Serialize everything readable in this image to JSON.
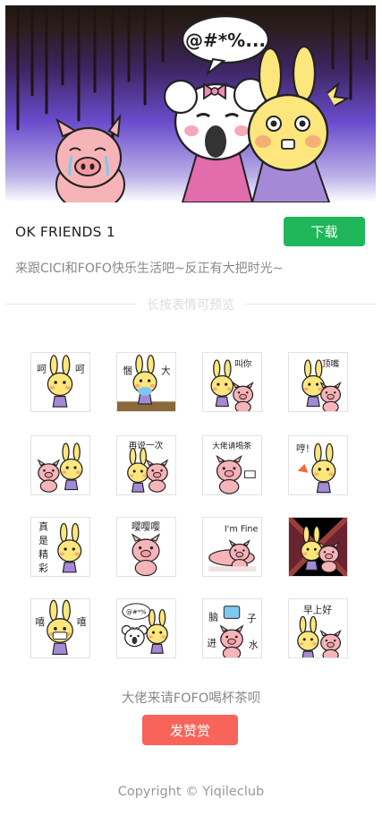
{
  "banner": {
    "speech_text": "@#*%...",
    "characters": [
      "pig-crying",
      "bear-with-bow",
      "bunny-surprised"
    ]
  },
  "pack": {
    "name": "OK FRIENDS 1",
    "download_label": "下载",
    "description": "来跟CICI和FOFO快乐生活吧~反正有大把时光~"
  },
  "preview_hint": "长按表情可预览",
  "stickers": [
    {
      "icon": "bunny-blowing-kiss-sticker",
      "text": "呵 呵"
    },
    {
      "icon": "bunny-crying-tv-sticker",
      "text": "悃 大"
    },
    {
      "icon": "bunny-pig-calling-sticker",
      "text": "叫你"
    },
    {
      "icon": "bunny-pig-talkback-sticker",
      "text": "顶嘴"
    },
    {
      "icon": "pig-bunny-whisper-sticker",
      "text": ""
    },
    {
      "icon": "bunny-pig-say-again-sticker",
      "text": "再说一次"
    },
    {
      "icon": "pig-tea-sticker",
      "text": "大佬请喝茶"
    },
    {
      "icon": "bunny-humph-sticker",
      "text": "哼!"
    },
    {
      "icon": "bunny-awesome-sticker",
      "text": "真是精彩"
    },
    {
      "icon": "pig-crying-sticker",
      "text": "嘤嘤嘤"
    },
    {
      "icon": "pig-im-fine-sticker",
      "text": "I'm Fine"
    },
    {
      "icon": "bunny-pig-dark-sticker",
      "text": ""
    },
    {
      "icon": "bunny-laughing-sticker",
      "text": "嘻 嘻"
    },
    {
      "icon": "bear-bunny-swearing-sticker",
      "text": "@#*%"
    },
    {
      "icon": "pig-water-brain-sticker",
      "text": "脑子进水"
    },
    {
      "icon": "bunny-pig-morning-sticker",
      "text": "早上好"
    }
  ],
  "footer": {
    "tip_text": "大佬来请FOFO喝杯茶呗",
    "reward_label": "发赞赏",
    "copyright": "Copyright © Yiqileclub"
  }
}
